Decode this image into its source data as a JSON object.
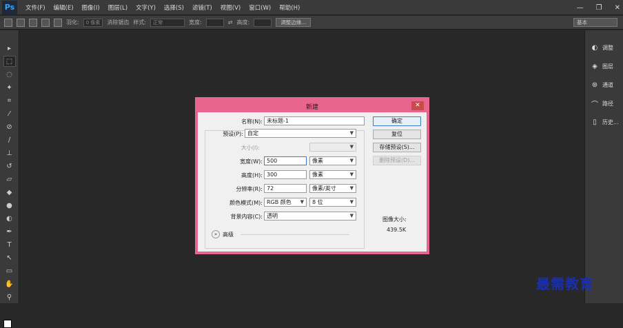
{
  "app": {
    "logo": "Ps"
  },
  "menu": [
    "文件(F)",
    "编辑(E)",
    "图像(I)",
    "图层(L)",
    "文字(Y)",
    "选择(S)",
    "滤镜(T)",
    "视图(V)",
    "窗口(W)",
    "帮助(H)"
  ],
  "window_controls": {
    "minimize": "—",
    "restore": "❐",
    "close": "✕"
  },
  "options": {
    "feather_label": "羽化:",
    "feather_value": "0 像素",
    "antialias_label": "消除锯齿",
    "style_label": "样式:",
    "style_value": "正常",
    "width_label": "宽度:",
    "height_label": "高度:",
    "refine_edge": "调整边缘...",
    "workspace": "基本"
  },
  "right_panels": [
    {
      "icon": "adjust",
      "label": "调整"
    },
    {
      "icon": "layers",
      "label": "图层"
    },
    {
      "icon": "channels",
      "label": "通道"
    },
    {
      "icon": "paths",
      "label": "路径"
    },
    {
      "icon": "history",
      "label": "历史..."
    }
  ],
  "dialog": {
    "title": "新建",
    "close": "✕",
    "name_label": "名称(N):",
    "name_value": "未标题-1",
    "preset_label": "预设(P):",
    "preset_value": "自定",
    "size_label": "大小(I):",
    "width_label": "宽度(W):",
    "width_value": "500",
    "width_unit": "像素",
    "height_label": "高度(H):",
    "height_value": "300",
    "height_unit": "像素",
    "resolution_label": "分辨率(R):",
    "resolution_value": "72",
    "resolution_unit": "像素/英寸",
    "color_mode_label": "颜色模式(M):",
    "color_mode_value": "RGB 颜色",
    "bit_depth_value": "8 位",
    "background_label": "背景内容(C):",
    "background_value": "透明",
    "advanced_label": "高级",
    "ok": "确定",
    "reset": "复位",
    "save_preset": "存储预设(S)...",
    "delete_preset": "删除预设(D)...",
    "image_size_label": "图像大小:",
    "image_size_value": "439.5K"
  },
  "watermark": "最需教育",
  "colors": {
    "dialog_frame": "#e8668e",
    "accent": "#3b7bd0",
    "watermark": "#1a2fb0"
  }
}
